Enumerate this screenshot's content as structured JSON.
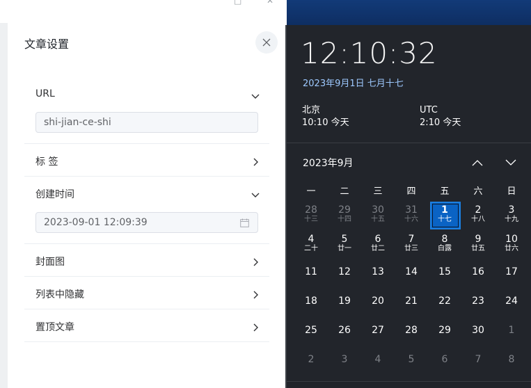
{
  "panel": {
    "title": "文章设置",
    "sections": [
      {
        "label": "URL",
        "expanded": true
      },
      {
        "label": "标 签",
        "expanded": false
      },
      {
        "label": "创建时间",
        "expanded": true
      },
      {
        "label": "封面图",
        "expanded": false
      },
      {
        "label": "列表中隐藏",
        "expanded": false
      },
      {
        "label": "置顶文章",
        "expanded": false
      }
    ],
    "url_value": "shi-jian-ce-shi",
    "created_value": "2023-09-01 12:09:39"
  },
  "flyout": {
    "time": "12:10:32",
    "date_full": "2023年9月1日 七月十七",
    "clocks": [
      {
        "city": "北京",
        "time": "10:10 今天"
      },
      {
        "city": "UTC",
        "time": "2:10 今天"
      }
    ],
    "month_title": "2023年9月",
    "weekdays": [
      "一",
      "二",
      "三",
      "四",
      "五",
      "六",
      "日"
    ],
    "weeks": [
      [
        {
          "n": "28",
          "l": "十三",
          "dim": true
        },
        {
          "n": "29",
          "l": "十四",
          "dim": true
        },
        {
          "n": "30",
          "l": "十五",
          "dim": true
        },
        {
          "n": "31",
          "l": "十六",
          "dim": true
        },
        {
          "n": "1",
          "l": "十七",
          "today": true
        },
        {
          "n": "2",
          "l": "十八"
        },
        {
          "n": "3",
          "l": "十九"
        }
      ],
      [
        {
          "n": "4",
          "l": "二十"
        },
        {
          "n": "5",
          "l": "廿一"
        },
        {
          "n": "6",
          "l": "廿二"
        },
        {
          "n": "7",
          "l": "廿三"
        },
        {
          "n": "8",
          "l": "白露"
        },
        {
          "n": "9",
          "l": "廿五"
        },
        {
          "n": "10",
          "l": "廿六"
        }
      ],
      [
        {
          "n": "11"
        },
        {
          "n": "12"
        },
        {
          "n": "13"
        },
        {
          "n": "14"
        },
        {
          "n": "15"
        },
        {
          "n": "16"
        },
        {
          "n": "17"
        }
      ],
      [
        {
          "n": "18"
        },
        {
          "n": "19"
        },
        {
          "n": "20"
        },
        {
          "n": "21"
        },
        {
          "n": "22"
        },
        {
          "n": "23"
        },
        {
          "n": "24"
        }
      ],
      [
        {
          "n": "25"
        },
        {
          "n": "26"
        },
        {
          "n": "27"
        },
        {
          "n": "28"
        },
        {
          "n": "29"
        },
        {
          "n": "30"
        },
        {
          "n": "1",
          "dim": true
        }
      ],
      [
        {
          "n": "2",
          "dim": true
        },
        {
          "n": "3",
          "dim": true
        },
        {
          "n": "4",
          "dim": true
        },
        {
          "n": "5",
          "dim": true
        },
        {
          "n": "6",
          "dim": true
        },
        {
          "n": "7",
          "dim": true
        },
        {
          "n": "8",
          "dim": true
        }
      ]
    ]
  },
  "colors": {
    "accent": "#0a63c4",
    "date_link": "#9ec9ff",
    "flyout_bg": "#22252b"
  }
}
